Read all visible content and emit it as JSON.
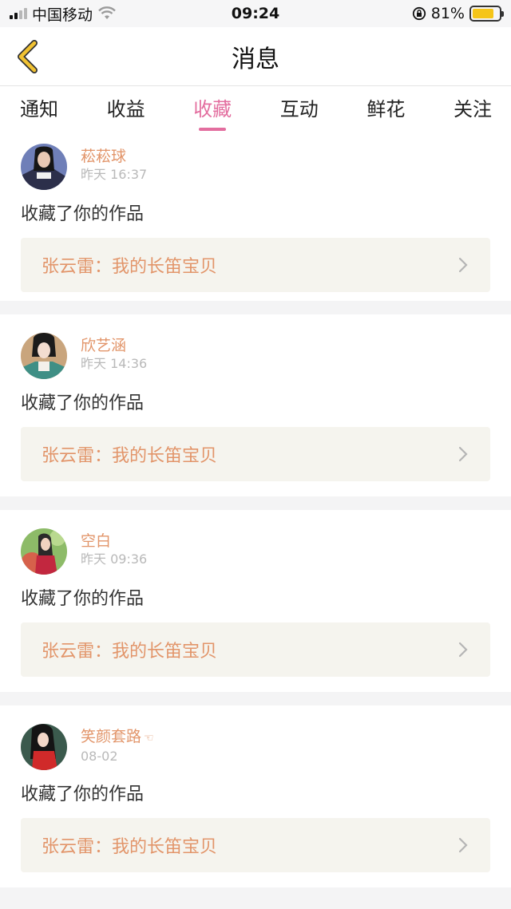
{
  "status_bar": {
    "carrier": "中国移动",
    "time": "09:24",
    "battery": "81%",
    "battery_level": 0.81
  },
  "header": {
    "title": "消息"
  },
  "tabs": [
    {
      "label": "通知",
      "active": false
    },
    {
      "label": "收益",
      "active": false
    },
    {
      "label": "收藏",
      "active": true
    },
    {
      "label": "互动",
      "active": false
    },
    {
      "label": "鲜花",
      "active": false
    },
    {
      "label": "关注",
      "active": false
    }
  ],
  "messages": [
    {
      "username": "菘菘球",
      "time": "昨天 16:37",
      "action": "收藏了你的作品",
      "work": "张云雷：我的长笛宝贝"
    },
    {
      "username": "欣艺涵",
      "time": "昨天 14:36",
      "action": "收藏了你的作品",
      "work": "张云雷：我的长笛宝贝"
    },
    {
      "username": "空白",
      "time": "昨天 09:36",
      "action": "收藏了你的作品",
      "work": "张云雷：我的长笛宝贝"
    },
    {
      "username": "笑颜套路",
      "username_suffix": "☜",
      "time": "08-02",
      "action": "收藏了你的作品",
      "work": "张云雷：我的长笛宝贝"
    }
  ],
  "colors": {
    "accent": "#e36e9f",
    "username": "#e2956a",
    "back_arrow": "#f1c232"
  }
}
